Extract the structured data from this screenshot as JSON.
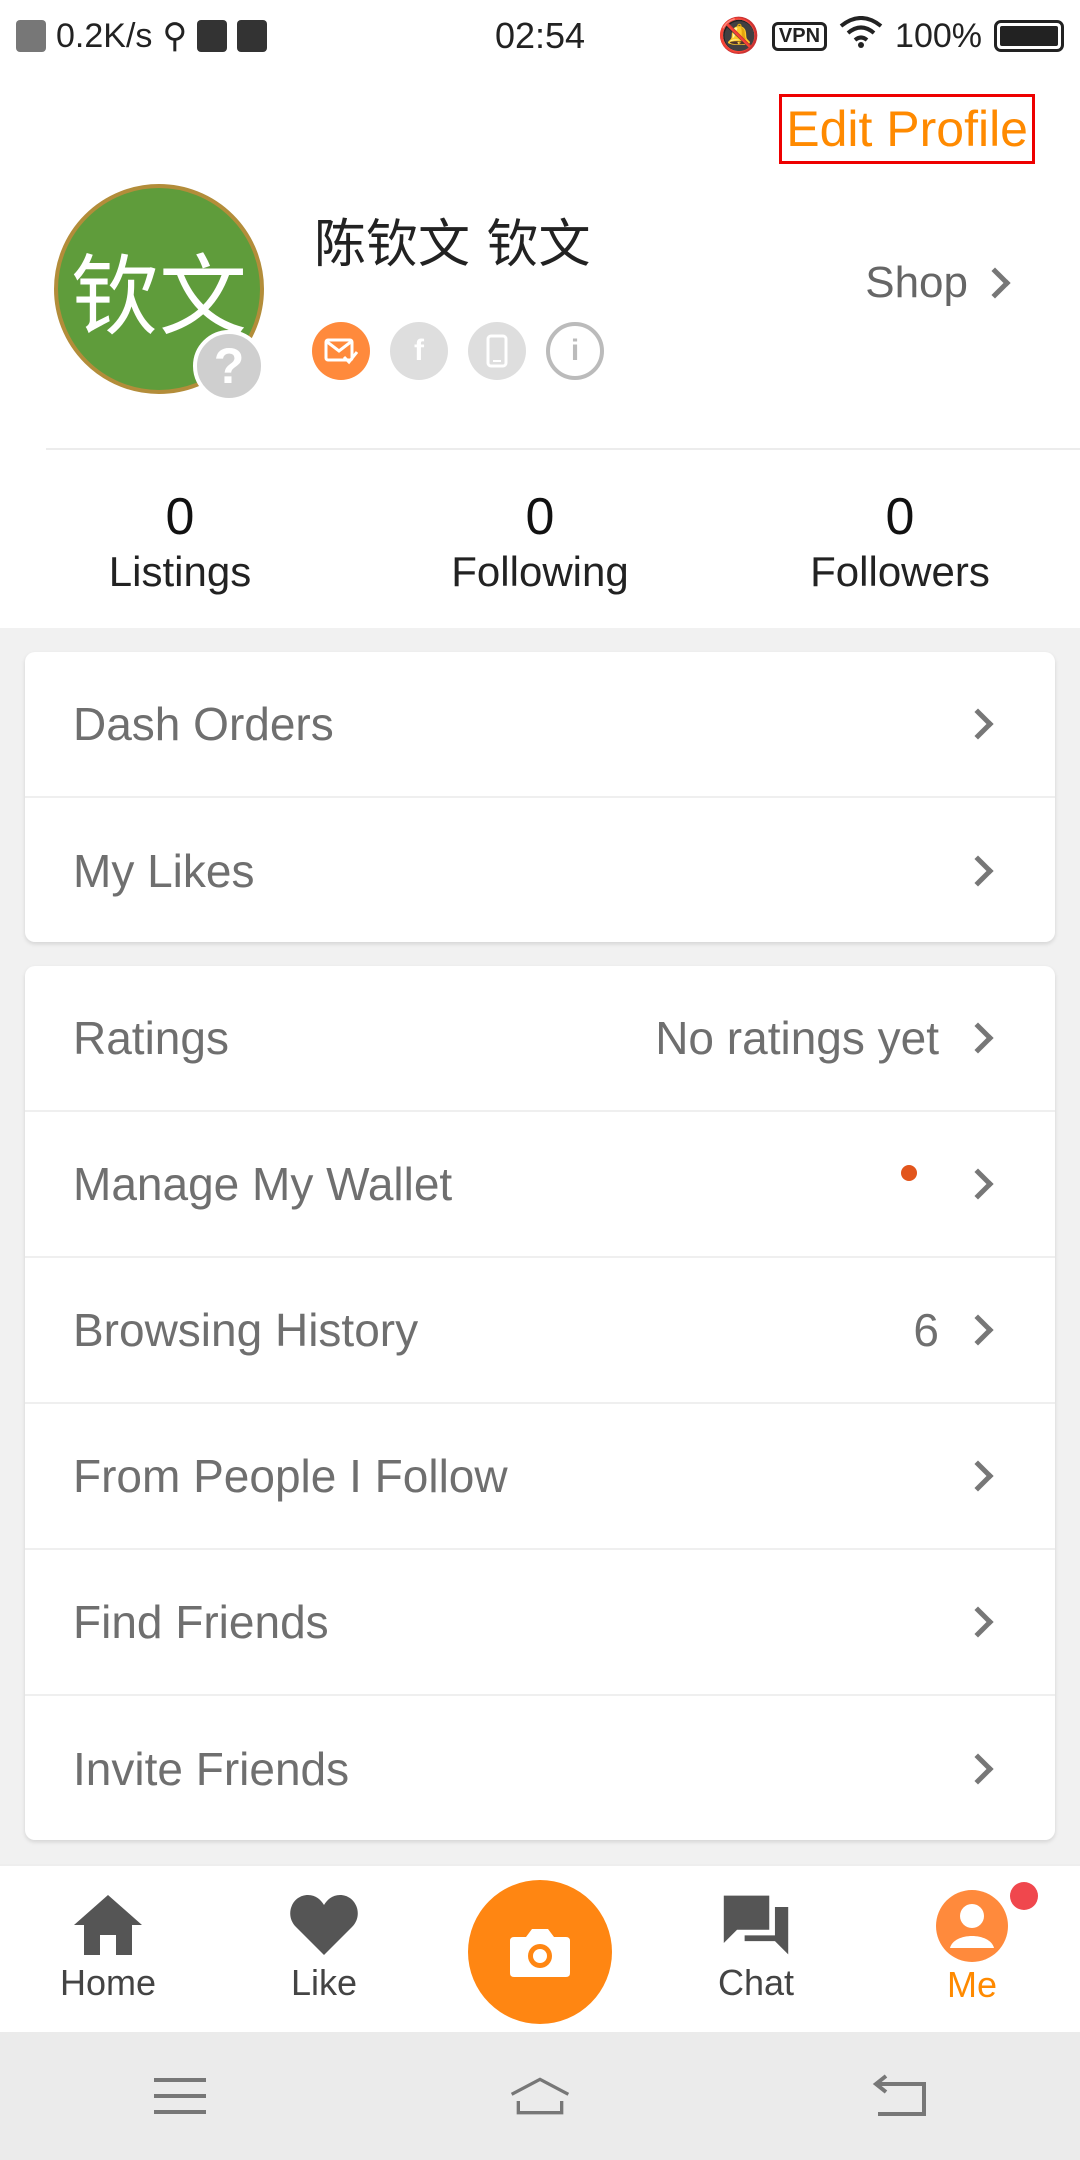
{
  "status_bar": {
    "speed": "0.2K/s",
    "time": "02:54",
    "vpn": "VPN",
    "battery": "100%"
  },
  "profile": {
    "edit_label": "Edit Profile",
    "avatar_text": "钦文",
    "avatar_help": "?",
    "username": "陈钦文 钦文",
    "shop_label": "Shop",
    "verify_icons": [
      "email-verified-icon",
      "facebook-icon",
      "phone-icon",
      "info-icon"
    ]
  },
  "stats": [
    {
      "value": "0",
      "label": "Listings"
    },
    {
      "value": "0",
      "label": "Following"
    },
    {
      "value": "0",
      "label": "Followers"
    }
  ],
  "menu_group_1": [
    {
      "label": "Dash Orders",
      "value": ""
    },
    {
      "label": "My Likes",
      "value": ""
    }
  ],
  "menu_group_2": [
    {
      "label": "Ratings",
      "value": "No ratings yet"
    },
    {
      "label": "Manage My Wallet",
      "value": "",
      "dot": true
    },
    {
      "label": "Browsing History",
      "value": "6"
    },
    {
      "label": "From People I Follow",
      "value": ""
    },
    {
      "label": "Find Friends",
      "value": ""
    },
    {
      "label": "Invite Friends",
      "value": ""
    }
  ],
  "bottom_nav": {
    "home": "Home",
    "like": "Like",
    "chat": "Chat",
    "me": "Me",
    "active": "me"
  },
  "colors": {
    "accent": "#ff8a00",
    "avatar_bg": "#5f9c3b",
    "badge": "#f0474d"
  }
}
